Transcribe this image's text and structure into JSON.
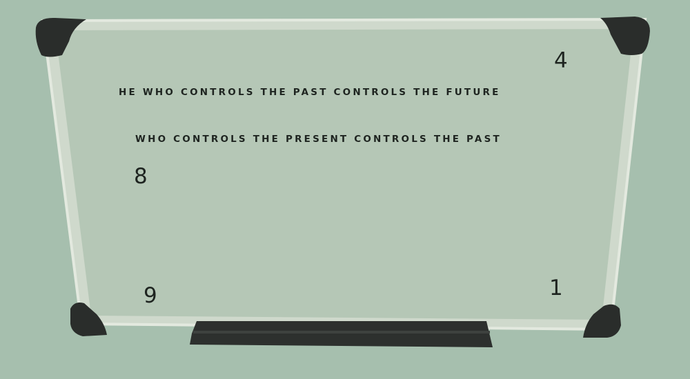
{
  "board": {
    "line1": "HE WHO CONTROLS THE PAST CONTROLS THE FUTURE",
    "line2": "WHO CONTROLS THE PRESENT CONTROLS THE PAST",
    "numbers": {
      "top_right": "4",
      "left": "8",
      "bottom_left": "9",
      "bottom_right": "1"
    }
  },
  "colors": {
    "wall": "#a6bfae",
    "board": "#b5c7b6",
    "frame": "#d4dccf",
    "corners": "#2a2d2b",
    "text": "#1e2420"
  }
}
